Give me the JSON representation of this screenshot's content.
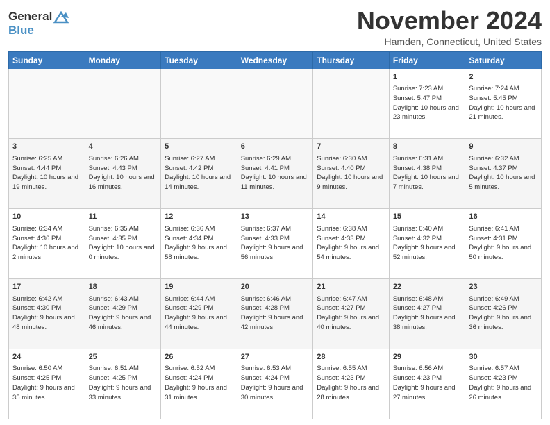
{
  "logo": {
    "line1": "General",
    "line2": "Blue"
  },
  "title": "November 2024",
  "subtitle": "Hamden, Connecticut, United States",
  "days_of_week": [
    "Sunday",
    "Monday",
    "Tuesday",
    "Wednesday",
    "Thursday",
    "Friday",
    "Saturday"
  ],
  "weeks": [
    [
      {
        "day": "",
        "info": ""
      },
      {
        "day": "",
        "info": ""
      },
      {
        "day": "",
        "info": ""
      },
      {
        "day": "",
        "info": ""
      },
      {
        "day": "",
        "info": ""
      },
      {
        "day": "1",
        "info": "Sunrise: 7:23 AM\nSunset: 5:47 PM\nDaylight: 10 hours and 23 minutes."
      },
      {
        "day": "2",
        "info": "Sunrise: 7:24 AM\nSunset: 5:45 PM\nDaylight: 10 hours and 21 minutes."
      }
    ],
    [
      {
        "day": "3",
        "info": "Sunrise: 6:25 AM\nSunset: 4:44 PM\nDaylight: 10 hours and 19 minutes."
      },
      {
        "day": "4",
        "info": "Sunrise: 6:26 AM\nSunset: 4:43 PM\nDaylight: 10 hours and 16 minutes."
      },
      {
        "day": "5",
        "info": "Sunrise: 6:27 AM\nSunset: 4:42 PM\nDaylight: 10 hours and 14 minutes."
      },
      {
        "day": "6",
        "info": "Sunrise: 6:29 AM\nSunset: 4:41 PM\nDaylight: 10 hours and 11 minutes."
      },
      {
        "day": "7",
        "info": "Sunrise: 6:30 AM\nSunset: 4:40 PM\nDaylight: 10 hours and 9 minutes."
      },
      {
        "day": "8",
        "info": "Sunrise: 6:31 AM\nSunset: 4:38 PM\nDaylight: 10 hours and 7 minutes."
      },
      {
        "day": "9",
        "info": "Sunrise: 6:32 AM\nSunset: 4:37 PM\nDaylight: 10 hours and 5 minutes."
      }
    ],
    [
      {
        "day": "10",
        "info": "Sunrise: 6:34 AM\nSunset: 4:36 PM\nDaylight: 10 hours and 2 minutes."
      },
      {
        "day": "11",
        "info": "Sunrise: 6:35 AM\nSunset: 4:35 PM\nDaylight: 10 hours and 0 minutes."
      },
      {
        "day": "12",
        "info": "Sunrise: 6:36 AM\nSunset: 4:34 PM\nDaylight: 9 hours and 58 minutes."
      },
      {
        "day": "13",
        "info": "Sunrise: 6:37 AM\nSunset: 4:33 PM\nDaylight: 9 hours and 56 minutes."
      },
      {
        "day": "14",
        "info": "Sunrise: 6:38 AM\nSunset: 4:33 PM\nDaylight: 9 hours and 54 minutes."
      },
      {
        "day": "15",
        "info": "Sunrise: 6:40 AM\nSunset: 4:32 PM\nDaylight: 9 hours and 52 minutes."
      },
      {
        "day": "16",
        "info": "Sunrise: 6:41 AM\nSunset: 4:31 PM\nDaylight: 9 hours and 50 minutes."
      }
    ],
    [
      {
        "day": "17",
        "info": "Sunrise: 6:42 AM\nSunset: 4:30 PM\nDaylight: 9 hours and 48 minutes."
      },
      {
        "day": "18",
        "info": "Sunrise: 6:43 AM\nSunset: 4:29 PM\nDaylight: 9 hours and 46 minutes."
      },
      {
        "day": "19",
        "info": "Sunrise: 6:44 AM\nSunset: 4:29 PM\nDaylight: 9 hours and 44 minutes."
      },
      {
        "day": "20",
        "info": "Sunrise: 6:46 AM\nSunset: 4:28 PM\nDaylight: 9 hours and 42 minutes."
      },
      {
        "day": "21",
        "info": "Sunrise: 6:47 AM\nSunset: 4:27 PM\nDaylight: 9 hours and 40 minutes."
      },
      {
        "day": "22",
        "info": "Sunrise: 6:48 AM\nSunset: 4:27 PM\nDaylight: 9 hours and 38 minutes."
      },
      {
        "day": "23",
        "info": "Sunrise: 6:49 AM\nSunset: 4:26 PM\nDaylight: 9 hours and 36 minutes."
      }
    ],
    [
      {
        "day": "24",
        "info": "Sunrise: 6:50 AM\nSunset: 4:25 PM\nDaylight: 9 hours and 35 minutes."
      },
      {
        "day": "25",
        "info": "Sunrise: 6:51 AM\nSunset: 4:25 PM\nDaylight: 9 hours and 33 minutes."
      },
      {
        "day": "26",
        "info": "Sunrise: 6:52 AM\nSunset: 4:24 PM\nDaylight: 9 hours and 31 minutes."
      },
      {
        "day": "27",
        "info": "Sunrise: 6:53 AM\nSunset: 4:24 PM\nDaylight: 9 hours and 30 minutes."
      },
      {
        "day": "28",
        "info": "Sunrise: 6:55 AM\nSunset: 4:23 PM\nDaylight: 9 hours and 28 minutes."
      },
      {
        "day": "29",
        "info": "Sunrise: 6:56 AM\nSunset: 4:23 PM\nDaylight: 9 hours and 27 minutes."
      },
      {
        "day": "30",
        "info": "Sunrise: 6:57 AM\nSunset: 4:23 PM\nDaylight: 9 hours and 26 minutes."
      }
    ]
  ]
}
